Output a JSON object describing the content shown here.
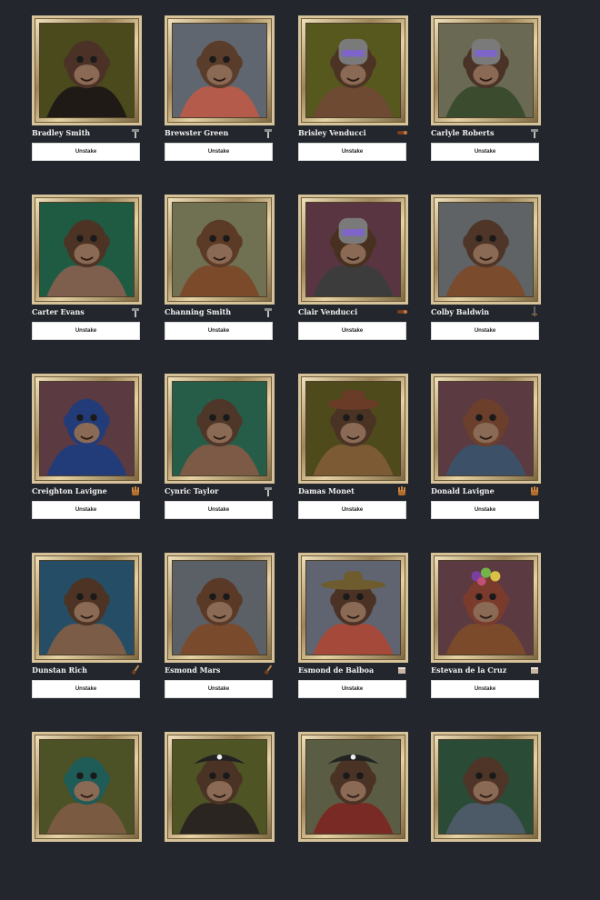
{
  "unstake_label": "Unstake",
  "colors": {
    "page_bg": "#23262c",
    "frame_gold": "#d6c39a",
    "button_bg": "#ffffff",
    "name_text": "#f1f1f1"
  },
  "cards": [
    {
      "name": "Bradley Smith",
      "tool_icon": "hammer-icon",
      "bg": "#4a4a1c",
      "fur": "#4b3126",
      "hat": "none",
      "clothes": "#1f1a16"
    },
    {
      "name": "Brewster Green",
      "tool_icon": "hammer-icon",
      "bg": "#5f6670",
      "fur": "#5a3c2b",
      "hat": "none",
      "clothes": "#b45b4b"
    },
    {
      "name": "Brisley Venducci",
      "tool_icon": "log-icon",
      "bg": "#56581e",
      "fur": "#4c3324",
      "hat": "helmet",
      "clothes": "#6d4a31"
    },
    {
      "name": "Carlyle Roberts",
      "tool_icon": "hammer-icon",
      "bg": "#6a6a54",
      "fur": "#4a3326",
      "hat": "helmet",
      "clothes": "#3b4b2d"
    },
    {
      "name": "Carter Evans",
      "tool_icon": "hammer-icon",
      "bg": "#1f5b43",
      "fur": "#4c3324",
      "hat": "none",
      "clothes": "#7e5f4e"
    },
    {
      "name": "Channing Smith",
      "tool_icon": "hammer-icon",
      "bg": "#707052",
      "fur": "#5b3a26",
      "hat": "none",
      "clothes": "#7a4a2b"
    },
    {
      "name": "Clair Venducci",
      "tool_icon": "log-icon",
      "bg": "#583541",
      "fur": "#47301f",
      "hat": "helmet",
      "clothes": "#3c3c3c"
    },
    {
      "name": "Colby Baldwin",
      "tool_icon": "sword-icon",
      "bg": "#5f6366",
      "fur": "#4e3527",
      "hat": "none",
      "clothes": "#7a4b2d"
    },
    {
      "name": "Creighton Lavigne",
      "tool_icon": "glove-icon",
      "bg": "#5b3a41",
      "fur": "#223c7a",
      "hat": "none",
      "clothes": "#223c7a"
    },
    {
      "name": "Cynric Taylor",
      "tool_icon": "hammer-icon",
      "bg": "#265d49",
      "fur": "#4e3728",
      "hat": "none",
      "clothes": "#7c5a45"
    },
    {
      "name": "Damas Monet",
      "tool_icon": "glove-icon",
      "bg": "#4f4a1b",
      "fur": "#4a3325",
      "hat": "cowboy",
      "clothes": "#7b5a34"
    },
    {
      "name": "Donald Lavigne",
      "tool_icon": "glove-icon",
      "bg": "#5b3a41",
      "fur": "#6b3f2c",
      "hat": "none",
      "clothes": "#3c5168"
    },
    {
      "name": "Dunstan Rich",
      "tool_icon": "brush-icon",
      "bg": "#254e66",
      "fur": "#4c3324",
      "hat": "none",
      "clothes": "#7a5c47"
    },
    {
      "name": "Esmond Mars",
      "tool_icon": "brush-icon",
      "bg": "#5b6066",
      "fur": "#5a3a27",
      "hat": "none",
      "clothes": "#7a4a2c"
    },
    {
      "name": "Esmond de Balboa",
      "tool_icon": "drum-icon",
      "bg": "#5f6470",
      "fur": "#4b3225",
      "hat": "sombrero",
      "clothes": "#a54a3a"
    },
    {
      "name": "Estevan de la Cruz",
      "tool_icon": "drum-icon",
      "bg": "#5b3a41",
      "fur": "#7a3b2c",
      "hat": "fruit",
      "clothes": "#7a4a2b"
    },
    {
      "name": "",
      "tool_icon": "",
      "bg": "#4c5126",
      "fur": "#1f5b57",
      "hat": "none",
      "clothes": "#7a5a40"
    },
    {
      "name": "",
      "tool_icon": "",
      "bg": "#4f5425",
      "fur": "#4a3224",
      "hat": "pirate",
      "clothes": "#2a2520"
    },
    {
      "name": "",
      "tool_icon": "",
      "bg": "#5a5d43",
      "fur": "#4a3224",
      "hat": "pirate",
      "clothes": "#7a2a25"
    },
    {
      "name": "",
      "tool_icon": "",
      "bg": "#2a4b35",
      "fur": "#4e3527",
      "hat": "none",
      "clothes": "#4b5a66"
    }
  ]
}
